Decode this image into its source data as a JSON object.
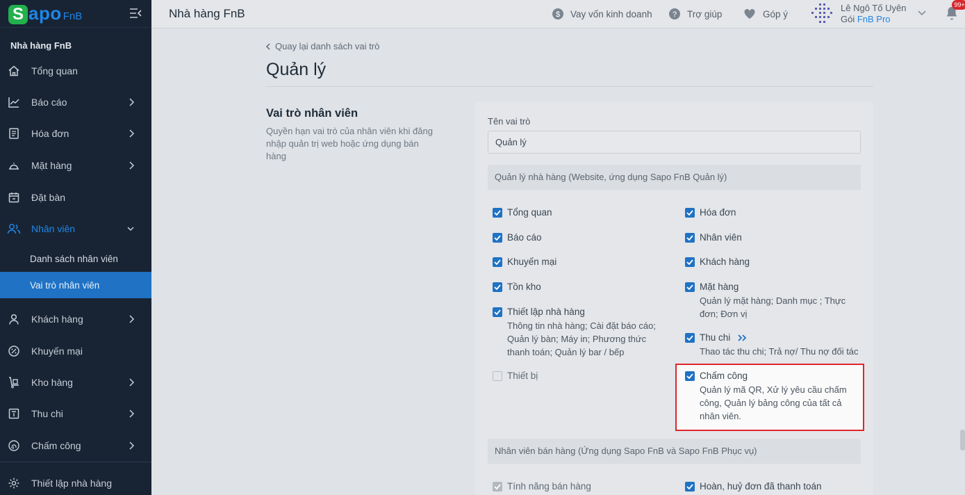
{
  "brand": {
    "s": "S",
    "apo": "apo",
    "fnb": "FnB"
  },
  "sidebar": {
    "store_name": "Nhà hàng FnB",
    "items": [
      {
        "label": "Tổng quan"
      },
      {
        "label": "Báo cáo"
      },
      {
        "label": "Hóa đơn"
      },
      {
        "label": "Mặt hàng"
      },
      {
        "label": "Đặt bàn"
      },
      {
        "label": "Nhân viên"
      },
      {
        "label": "Khách hàng"
      },
      {
        "label": "Khuyến mại"
      },
      {
        "label": "Kho hàng"
      },
      {
        "label": "Thu chi"
      },
      {
        "label": "Chấm công"
      },
      {
        "label": "Thiết lập nhà hàng"
      }
    ],
    "sub_items": [
      {
        "label": "Danh sách nhân viên"
      },
      {
        "label": "Vai trò nhân viên"
      }
    ]
  },
  "topbar": {
    "title": "Nhà hàng FnB",
    "loan": "Vay vốn kinh doanh",
    "help": "Trợ giúp",
    "feedback": "Góp ý",
    "user_name": "Lê Ngô Tố Uyên",
    "plan_prefix": "Gói ",
    "plan_name": "FnB Pro",
    "notif_count": "99+"
  },
  "main": {
    "back": "Quay lại danh sách vai trò",
    "title": "Quản lý",
    "section_title": "Vai trò nhân viên",
    "section_desc": "Quyền hạn vai trò của nhân viên khi đăng nhập quản trị web hoặc ứng dụng bán hàng",
    "role_label": "Tên vai trò",
    "role_value": "Quản lý",
    "group1": "Quản lý nhà hàng (Website, ứng dụng Sapo FnB Quản lý)",
    "group2": "Nhân viên bán hàng (Ứng dụng Sapo FnB và Sapo FnB Phục vụ)",
    "perms": {
      "tong_quan": "Tổng quan",
      "bao_cao": "Báo cáo",
      "khuyen_mai": "Khuyến mại",
      "ton_kho": "Tồn kho",
      "thiet_lap": "Thiết lập nhà hàng",
      "thiet_lap_sub1": "Thông tin nhà hàng; Cài đặt báo cáo;",
      "thiet_lap_sub2": "Quản lý bàn; Máy in; Phương thức",
      "thiet_lap_sub3": "thanh toán; Quản lý bar / bếp",
      "thiet_bi": "Thiết bị",
      "hoa_don": "Hóa đơn",
      "nhan_vien": "Nhân viên",
      "khach_hang": "Khách hàng",
      "mat_hang": "Mặt hàng",
      "mat_hang_sub1": "Quản lý mặt hàng; Danh mục ; Thực",
      "mat_hang_sub2": "đơn; Đơn vị",
      "thu_chi": "Thu chi",
      "thu_chi_sub": "Thao tác thu chi; Trả nợ/ Thu nợ đối tác",
      "cham_cong": "Chấm công",
      "cham_cong_sub1": "Quản lý mã QR, Xử lý yêu cầu chấm",
      "cham_cong_sub2": "công, Quản lý bảng công của tất cả",
      "cham_cong_sub3": "nhân viên.",
      "tinh_nang": "Tính năng bán hàng",
      "hoan_huy": "Hoàn, huỷ đơn đã thanh toán"
    }
  },
  "colors": {
    "sidebar_bg": "#182433",
    "accent": "#1f72c4",
    "highlight": "#e1242b"
  }
}
